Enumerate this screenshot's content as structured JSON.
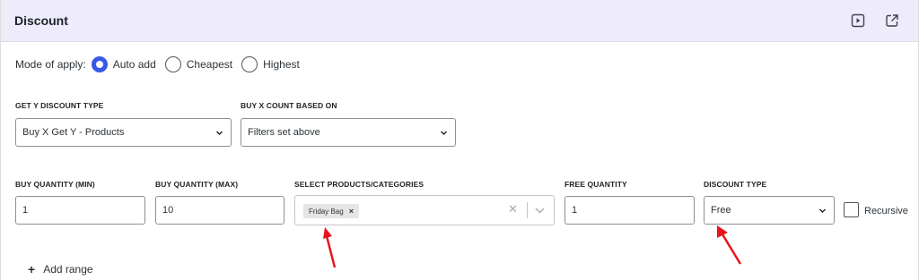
{
  "header": {
    "title": "Discount",
    "icons": [
      "play-icon",
      "external-link-icon"
    ]
  },
  "mode": {
    "label": "Mode of apply:",
    "options": [
      {
        "label": "Auto add",
        "checked": true
      },
      {
        "label": "Cheapest",
        "checked": false
      },
      {
        "label": "Highest",
        "checked": false
      }
    ]
  },
  "get_y_type": {
    "label": "GET Y DISCOUNT TYPE",
    "value": "Buy X Get Y - Products"
  },
  "buy_x_count": {
    "label": "BUY X COUNT BASED ON",
    "value": "Filters set above"
  },
  "range": {
    "buy_min": {
      "label": "BUY QUANTITY (MIN)",
      "value": "1"
    },
    "buy_max": {
      "label": "BUY QUANTITY (MAX)",
      "value": "10"
    },
    "products": {
      "label": "SELECT PRODUCTS/CATEGORIES",
      "chips": [
        "Friday Bag"
      ]
    },
    "free_qty": {
      "label": "FREE QUANTITY",
      "value": "1"
    },
    "discount_type": {
      "label": "DISCOUNT TYPE",
      "value": "Free"
    },
    "recursive_label": "Recursive",
    "recursive_checked": false
  },
  "add_range_label": "Add range",
  "colors": {
    "accent": "#3858e9",
    "header_bg": "#eeecfb",
    "arrow": "#e8141c"
  }
}
